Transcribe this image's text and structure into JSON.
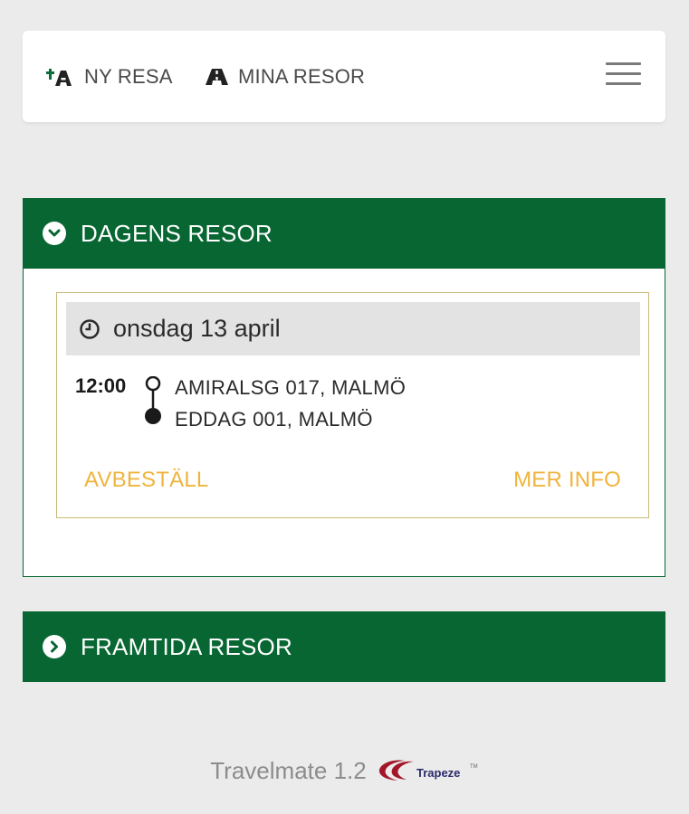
{
  "nav": {
    "new_trip_label": "NY RESA",
    "my_trips_label": "MINA RESOR"
  },
  "today": {
    "header": "DAGENS RESOR",
    "card": {
      "date": "onsdag 13 april",
      "time": "12:00",
      "from": "AMIRALSG 017, MALMÖ",
      "to": "EDDAG 001, MALMÖ",
      "cancel_label": "AVBESTÄLL",
      "info_label": "MER INFO"
    }
  },
  "future": {
    "header": "FRAMTIDA RESOR"
  },
  "footer": {
    "version": "Travelmate 1.2",
    "logo_text": "Trapeze"
  },
  "colors": {
    "brand_green": "#076632",
    "action_orange": "#f0b43c",
    "card_border": "#c9b878",
    "background": "#ebebeb"
  }
}
